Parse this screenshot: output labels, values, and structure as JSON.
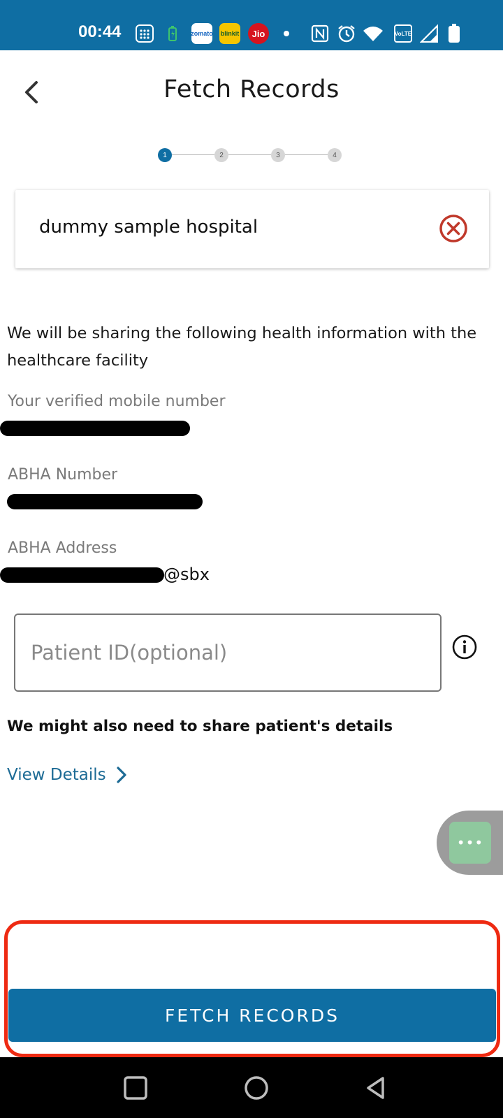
{
  "status_bar": {
    "time": "00:44",
    "apps": [
      "zomato",
      "blinkit",
      "Jio"
    ],
    "network_label": "VoLTE",
    "colors": {
      "background": "#0f6ea3",
      "zomato": "#ffffff",
      "blinkit": "#f6c500",
      "jio": "#d6141f"
    },
    "icons": [
      "calculator-icon",
      "battery-saver-icon",
      "nfc-icon",
      "alarm-icon",
      "wifi-icon",
      "signal-icon",
      "battery-icon"
    ]
  },
  "header": {
    "title": "Fetch Records",
    "back_icon": "chevron-left-icon"
  },
  "stepper": {
    "steps": [
      "1",
      "2",
      "3",
      "4"
    ],
    "active_step": 1
  },
  "hospital": {
    "name": "dummy sample hospital",
    "clear_icon": "close-circle-icon"
  },
  "sharing": {
    "intro": "We will be sharing the following health information with the healthcare facility",
    "mobile_label": "Your verified mobile number",
    "abha_number_label": "ABHA Number",
    "abha_address_label": "ABHA Address",
    "abha_address_suffix": "@sbx"
  },
  "patient_id": {
    "placeholder": "Patient ID(optional)",
    "value": ""
  },
  "patient_details": {
    "note": "We might also need to share patient's details",
    "view_details_label": "View Details"
  },
  "actions": {
    "fetch_label": "FETCH RECORDS"
  },
  "floating_button": {
    "label": "•••"
  },
  "theme": {
    "primary": "#0f6ea3",
    "link": "#1d6b95",
    "clear": "#c0392b",
    "highlight": "#ee2a12"
  }
}
